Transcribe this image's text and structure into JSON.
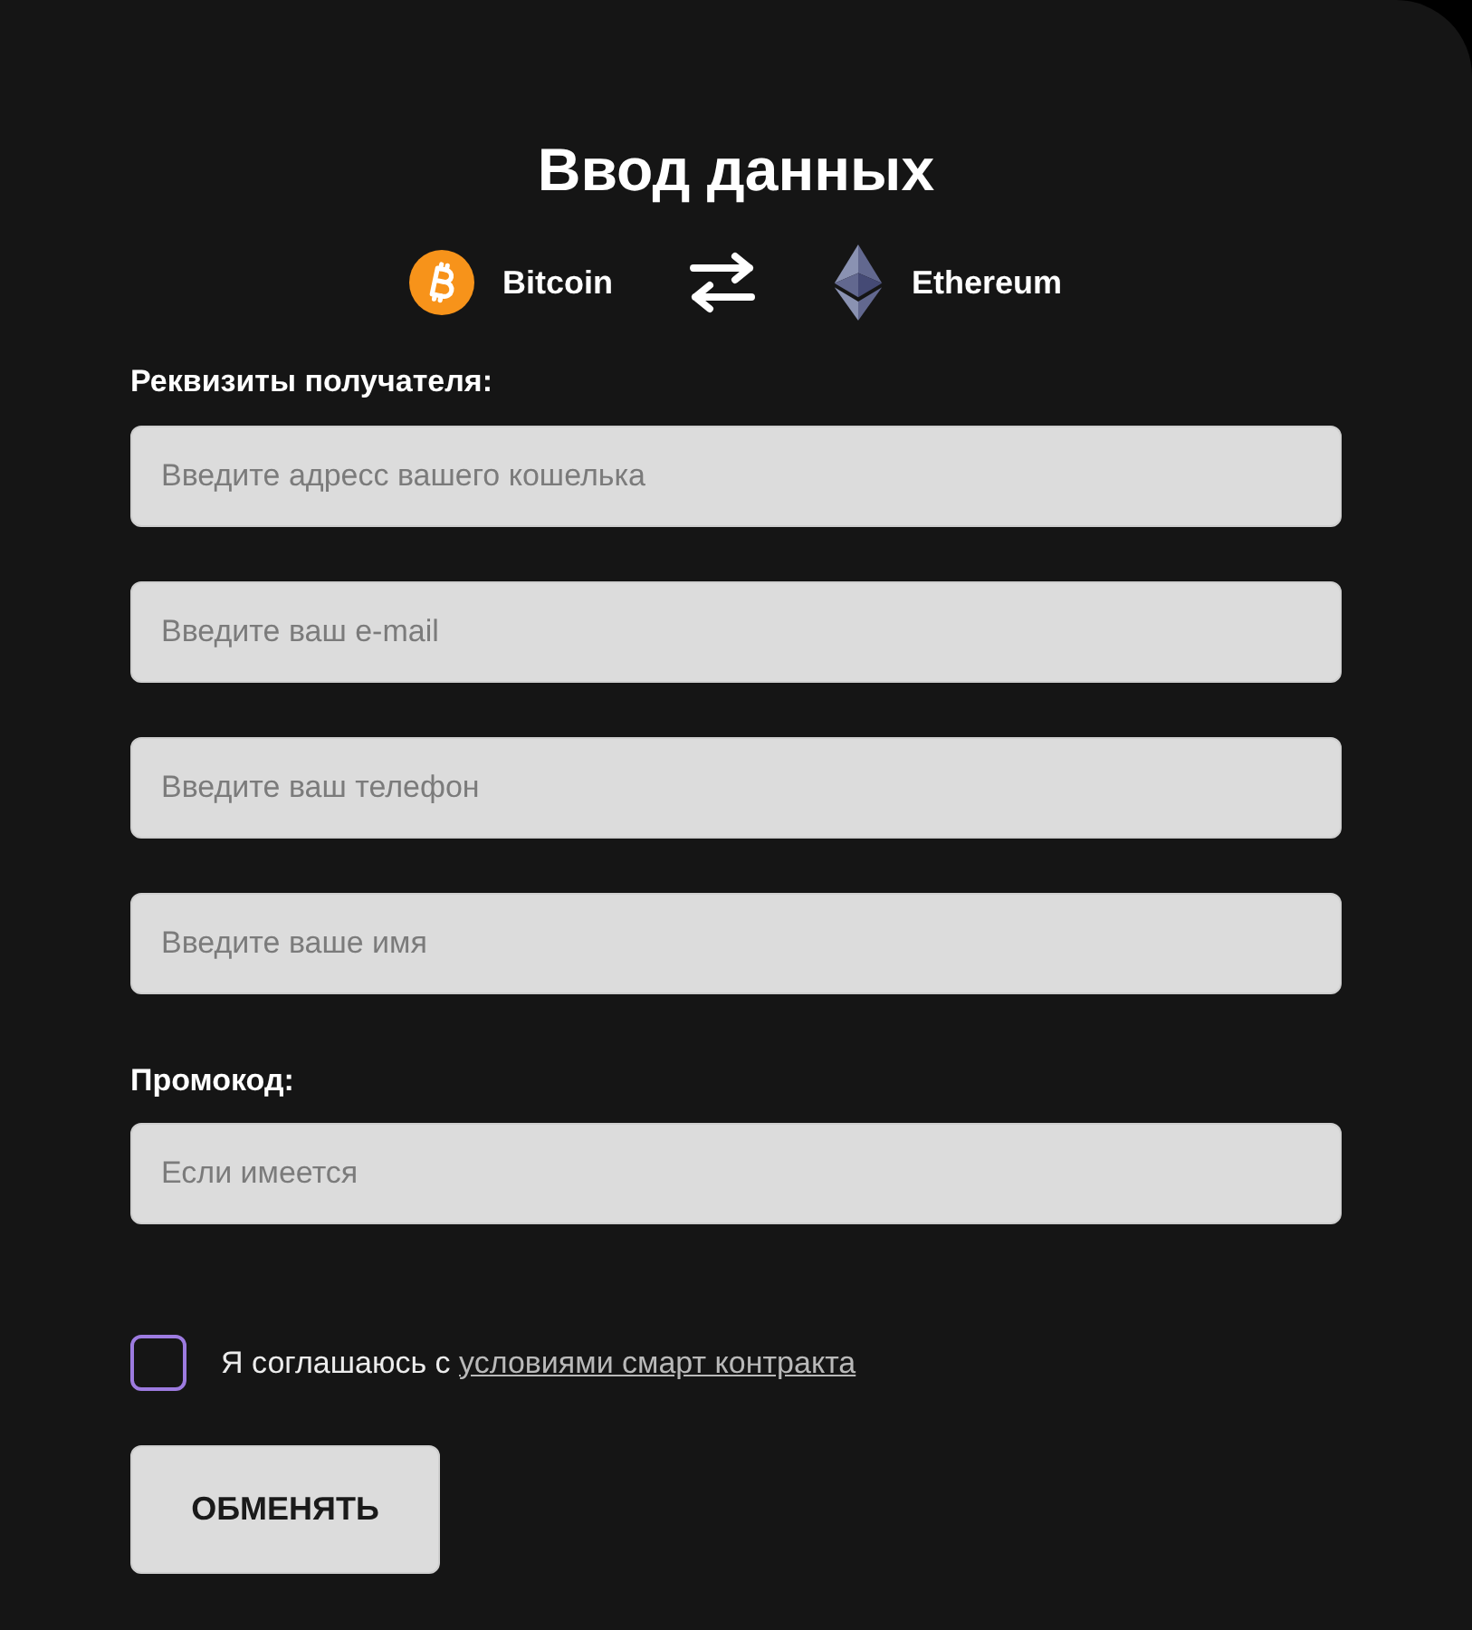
{
  "title": "Ввод данных",
  "exchange": {
    "from": {
      "kind": "bitcoin",
      "name": "Bitcoin"
    },
    "to": {
      "kind": "ethereum",
      "name": "Ethereum"
    }
  },
  "recipient": {
    "label": "Реквизиты получателя:",
    "fields": [
      {
        "placeholder": "Введите адресс вашего кошелька"
      },
      {
        "placeholder": "Введите ваш e-mail"
      },
      {
        "placeholder": "Введите ваш телефон"
      },
      {
        "placeholder": "Введите ваше имя"
      }
    ]
  },
  "promo": {
    "label": "Промокод:",
    "field": {
      "placeholder": "Если имеется"
    }
  },
  "agreement": {
    "checked": false,
    "text": "Я соглашаюсь с",
    "link": "условиями смарт контракта"
  },
  "submit": {
    "label": "ОБМЕНЯТЬ"
  }
}
